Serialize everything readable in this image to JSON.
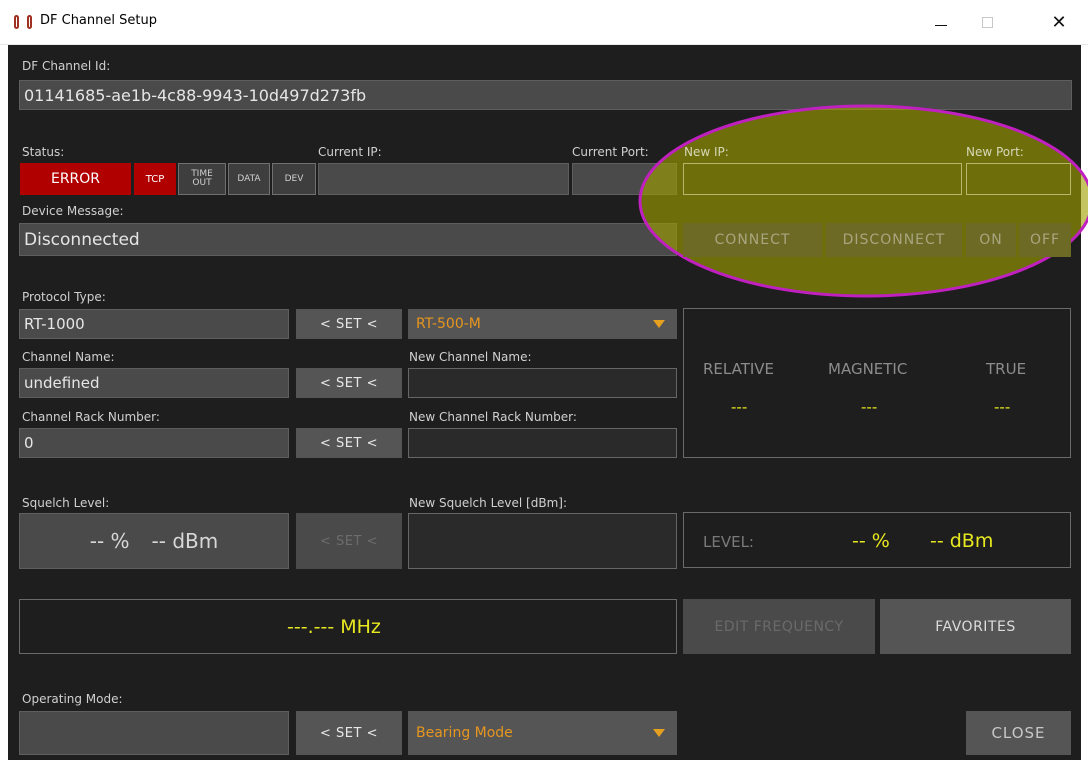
{
  "window": {
    "title": "DF Channel Setup",
    "minimize_glyph": "",
    "maximize_glyph": "",
    "close_glyph": "✕"
  },
  "channel_id": {
    "label": "DF Channel Id:",
    "value": "01141685-ae1b-4c88-9943-10d497d273fb"
  },
  "status": {
    "label": "Status:",
    "error_label": "ERROR",
    "chips": {
      "tcp": "TCP",
      "timeout_top": "TIME",
      "timeout_bottom": "OUT",
      "data": "DATA",
      "dev": "DEV"
    }
  },
  "connection": {
    "current_ip_label": "Current IP:",
    "current_ip_value": "",
    "current_port_label": "Current Port:",
    "current_port_value": "",
    "new_ip_label": "New IP:",
    "new_ip_value": "",
    "new_port_label": "New Port:",
    "new_port_value": "",
    "connect_label": "CONNECT",
    "disconnect_label": "DISCONNECT",
    "on_label": "ON",
    "off_label": "OFF"
  },
  "device_message": {
    "label": "Device Message:",
    "value": "Disconnected"
  },
  "protocol": {
    "label": "Protocol Type:",
    "value": "RT-1000",
    "set_label": "< SET <",
    "dropdown_value": "RT-500-M"
  },
  "channel_name": {
    "label": "Channel Name:",
    "value": "undefined",
    "set_label": "< SET <",
    "new_label": "New Channel Name:",
    "new_value": ""
  },
  "rack_number": {
    "label": "Channel Rack Number:",
    "value": "0",
    "set_label": "< SET <",
    "new_label": "New Channel Rack Number:",
    "new_value": ""
  },
  "bearing": {
    "relative_label": "RELATIVE",
    "magnetic_label": "MAGNETIC",
    "true_label": "TRUE",
    "relative_value": "---",
    "magnetic_value": "---",
    "true_value": "---"
  },
  "squelch": {
    "label": "Squelch Level:",
    "percent_text": "-- %",
    "dbm_text": "-- dBm",
    "set_label": "< SET <",
    "new_label": "New Squelch Level [dBm]:",
    "new_value": ""
  },
  "level": {
    "label": "LEVEL:",
    "percent_text": "-- %",
    "dbm_text": "-- dBm"
  },
  "frequency": {
    "value": "---.--- MHz",
    "edit_label": "EDIT FREQUENCY",
    "favorites_label": "FAVORITES"
  },
  "operating_mode": {
    "label": "Operating Mode:",
    "value": "",
    "set_label": "< SET <",
    "dropdown_value": "Bearing Mode"
  },
  "close_label": "CLOSE",
  "colors": {
    "background": "#1e1e1e",
    "error_red": "#b00000",
    "accent_yellow": "#e8e820",
    "dropdown_orange": "#e6961e",
    "highlight_fill": "#a0a000",
    "highlight_stroke": "#c020c0"
  }
}
